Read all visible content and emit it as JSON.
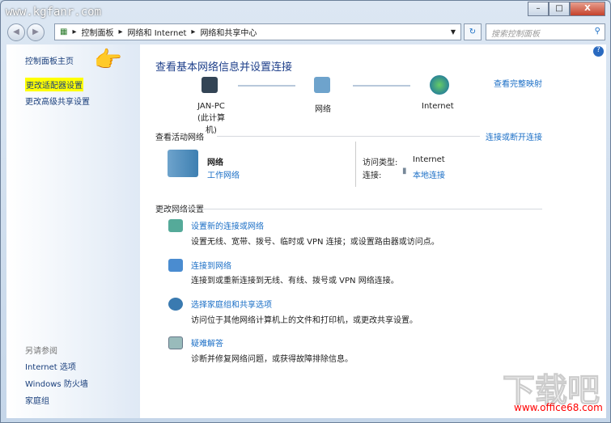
{
  "window": {
    "watermark": "www.kgfanr.com",
    "min": "–",
    "max": "□",
    "close": "X"
  },
  "address": {
    "segments": [
      "控制面板",
      "网络和 Internet",
      "网络和共享中心"
    ],
    "search_placeholder": "搜索控制面板"
  },
  "sidebar": {
    "home": "控制面板主页",
    "items": [
      "更改适配器设置",
      "更改高级共享设置"
    ],
    "see_also": "另请参阅",
    "see_also_items": [
      "Internet 选项",
      "Windows 防火墙",
      "家庭组"
    ]
  },
  "main": {
    "title": "查看基本网络信息并设置连接",
    "full_map": "查看完整映射",
    "map": [
      {
        "label": "JAN-PC",
        "sub": "(此计算机)"
      },
      {
        "label": "网络"
      },
      {
        "label": "Internet"
      }
    ],
    "active_header": "查看活动网络",
    "connect_link": "连接或断开连接",
    "network_name": "网络",
    "network_type": "工作网络",
    "access_label": "访问类型:",
    "access_value": "Internet",
    "conn_label": "连接:",
    "conn_value": "本地连接",
    "change_header": "更改网络设置",
    "tasks": [
      {
        "title": "设置新的连接或网络",
        "desc": "设置无线、宽带、拨号、临时或 VPN 连接；或设置路由器或访问点。"
      },
      {
        "title": "连接到网络",
        "desc": "连接到或重新连接到无线、有线、拨号或 VPN 网络连接。"
      },
      {
        "title": "选择家庭组和共享选项",
        "desc": "访问位于其他网络计算机上的文件和打印机，或更改共享设置。"
      },
      {
        "title": "疑难解答",
        "desc": "诊断并修复网络问题，或获得故障排除信息。"
      }
    ]
  },
  "watermark2": {
    "logo": "下载吧",
    "url": "www.office68.com"
  }
}
